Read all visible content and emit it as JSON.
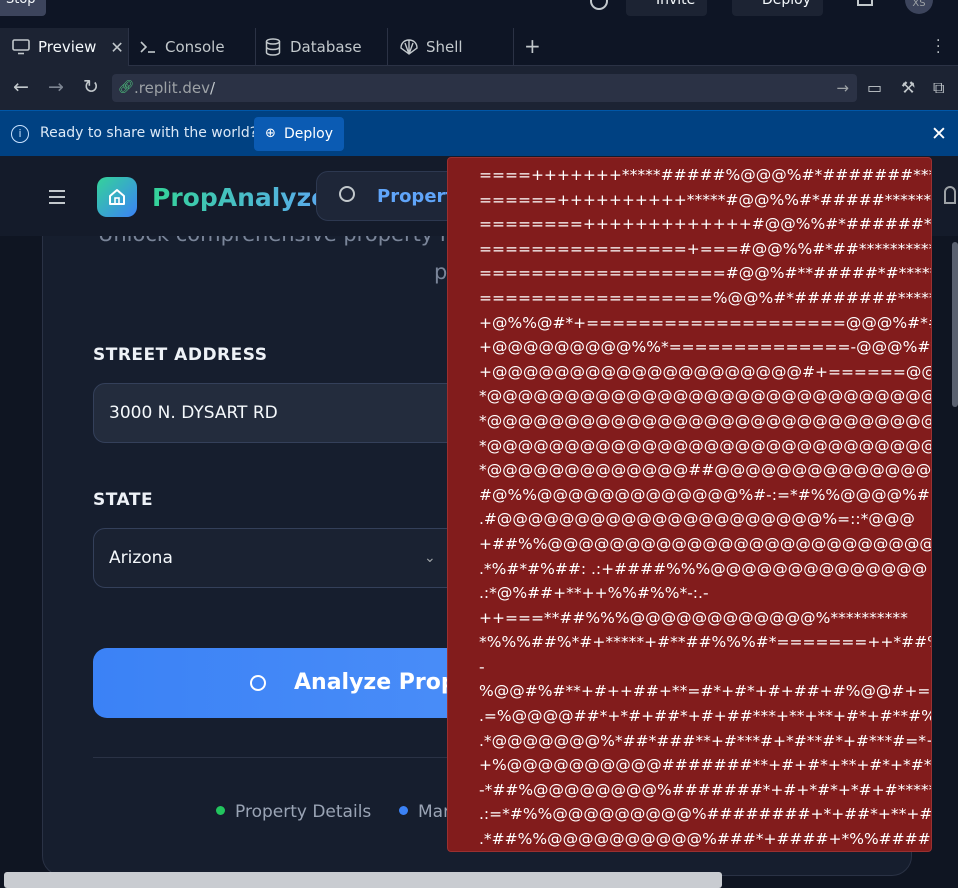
{
  "topbar": {
    "stop_label": "Stop",
    "invite_label": "Invite",
    "deploy_label": "Deploy",
    "avatar_initials": "XS"
  },
  "tabs": [
    {
      "label": "Preview",
      "icon": "monitor-icon",
      "active": true
    },
    {
      "label": "Console",
      "icon": "terminal-icon"
    },
    {
      "label": "Database",
      "icon": "database-icon"
    },
    {
      "label": "Shell",
      "icon": "shell-icon"
    }
  ],
  "url_bar": {
    "domain": ".replit.dev",
    "path": "/"
  },
  "banner": {
    "message": "Ready to share with the world?",
    "button_label": "Deploy"
  },
  "app": {
    "brand": "PropAnalyzed",
    "search_label": "Property",
    "subtitle_line1": "Unlock comprehensive property ins",
    "subtitle_line2": "p",
    "street_label": "STREET ADDRESS",
    "street_value": "3000 N. DYSART RD",
    "state_label": "STATE",
    "state_value": "Arizona",
    "analyze_label": "Analyze Prope",
    "legend": [
      {
        "label": "Property Details",
        "color": "#22c55e"
      },
      {
        "label": "Mar",
        "color": "#3b82f6"
      }
    ]
  },
  "overlay": {
    "background": "#821c1c",
    "lines": [
      "====+++++++*****#####%@@@%#*#######*********",
      "======++++++++++*****#@@%%#*#####************",
      "========+++++++++++++#@@%%#*######**********",
      "================+===#@@%%#*##**************",
      "===================#@@%#**#####*#**********",
      "==================%@@%#*########***********",
      "+@%%@#*+====================@@@%#*####",
      "+@@@@@@@@@%%*==============-@@@%#*",
      "+@@@@@@@@@@@@@@@@@@@@#+======@@",
      "*@@@@@@@@@@@@@@@@@@@@@@@@@@@@@@@",
      "*@@@@@@@@@@@@@@@@@@@@@@@@@@@@@@@",
      "*@@@@@@@@@@@@@@@@@@@@@@@@@@@@@@@",
      "*@@@@@@@@@@@@@##@@@@@@@@@@@@@@@",
      "#@%%@@@@@@@@@@@@@%#-:=*#%%@@@@%#",
      ".#@@@@@@@@@@@@@@@@@@@@@%=::*@@@",
      "+##%%@@@@@@@@@@@@@@@@@@@@@@@@@@",
      ".*%#*#%##: .:+####%%%@@@@@@@@@@@@@@",
      ".:*@%##+**++%%#%%*-:.-",
      "++===**##%%%@@@@@@@@@@@@%**********",
      "*%%%##%*#+*****+#**##%%%#*=======++*##%%%%",
      "-",
      "%@@#%#**+#++##+**=#*+#*+#+##+#%@@#+=======",
      ".=%@@@@##*+*#+##*+#+##***+**+**+#*+#**#%%@#",
      ".*@@@@@@@%*##*###**+#***#+*#**#*+#***#=*+*#*",
      "+%@@@@@@@@@@#######**+#+#*+**+#*+*#*+#*",
      "-*##%@@@@@@@@%#######*+#+*#*+*#+#*****",
      ".:=*#%%@@@@@@@@@%########+*+##*+**+#",
      ".*##%%@@@@@@@@@@%###*+####+*%%####****"
    ]
  }
}
